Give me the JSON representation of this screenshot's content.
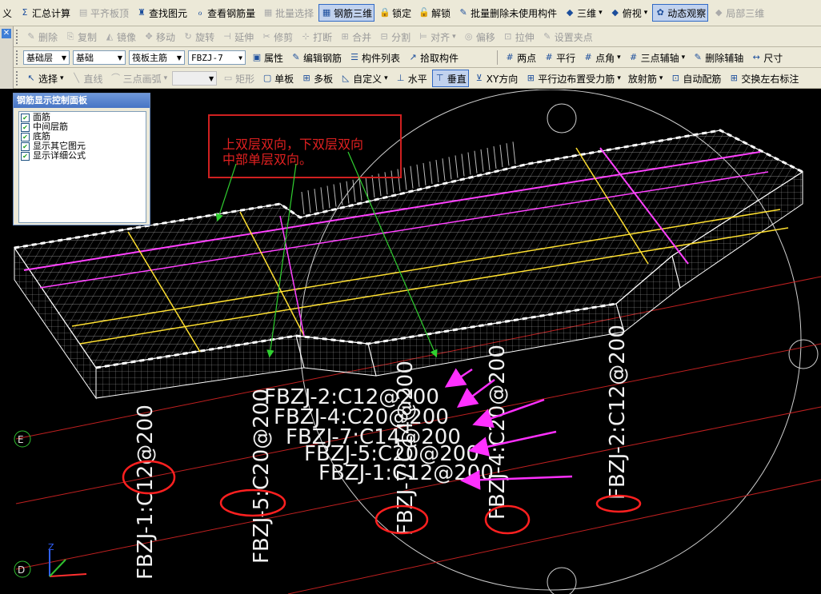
{
  "toolbar1": [
    {
      "label": "义",
      "icon": "",
      "disabled": false
    },
    {
      "label": "汇总计算",
      "icon": "Σ",
      "disabled": false
    },
    {
      "label": "平齐板顶",
      "icon": "▤",
      "disabled": true
    },
    {
      "label": "查找图元",
      "icon": "♜",
      "disabled": false
    },
    {
      "label": "查看钢筋量",
      "icon": "ℴ",
      "disabled": false
    },
    {
      "label": "批量选择",
      "icon": "▦",
      "disabled": true
    },
    {
      "label": "钢筋三维",
      "icon": "▦",
      "disabled": false,
      "active": true
    },
    {
      "label": "锁定",
      "icon": "🔒",
      "disabled": false
    },
    {
      "label": "解锁",
      "icon": "🔓",
      "disabled": false
    },
    {
      "label": "批量删除未使用构件",
      "icon": "✎",
      "disabled": false
    },
    {
      "label": "三维",
      "icon": "◆",
      "disabled": false,
      "dropdown": true
    },
    {
      "label": "俯视",
      "icon": "◆",
      "disabled": false,
      "dropdown": true
    },
    {
      "label": "动态观察",
      "icon": "✿",
      "disabled": false,
      "active": true
    },
    {
      "label": "局部三维",
      "icon": "◆",
      "disabled": true
    }
  ],
  "toolbar2": [
    {
      "label": "删除",
      "icon": "✎",
      "disabled": true
    },
    {
      "label": "复制",
      "icon": "⎘",
      "disabled": true
    },
    {
      "label": "镜像",
      "icon": "◭",
      "disabled": true
    },
    {
      "label": "移动",
      "icon": "✥",
      "disabled": true
    },
    {
      "label": "旋转",
      "icon": "↻",
      "disabled": true
    },
    {
      "label": "延伸",
      "icon": "⊣",
      "disabled": true
    },
    {
      "label": "修剪",
      "icon": "✂",
      "disabled": true
    },
    {
      "label": "打断",
      "icon": "⊹",
      "disabled": true
    },
    {
      "label": "合并",
      "icon": "⊞",
      "disabled": true
    },
    {
      "label": "分割",
      "icon": "⊟",
      "disabled": true
    },
    {
      "label": "对齐",
      "icon": "⊨",
      "disabled": true,
      "dropdown": true
    },
    {
      "label": "偏移",
      "icon": "◎",
      "disabled": true
    },
    {
      "label": "拉伸",
      "icon": "⊡",
      "disabled": true
    },
    {
      "label": "设置夹点",
      "icon": "✎",
      "disabled": true
    }
  ],
  "toolbar3": {
    "floor": "基础层",
    "category": "基础",
    "type": "筏板主筋",
    "element": "FBZJ-7",
    "buttons": [
      {
        "label": "属性",
        "icon": "▣"
      },
      {
        "label": "编辑钢筋",
        "icon": "✎"
      },
      {
        "label": "构件列表",
        "icon": "☰"
      },
      {
        "label": "拾取构件",
        "icon": "↗"
      }
    ],
    "buttons_right": [
      {
        "label": "两点",
        "icon": "#"
      },
      {
        "label": "平行",
        "icon": "#"
      },
      {
        "label": "点角",
        "icon": "#",
        "dropdown": true
      },
      {
        "label": "三点辅轴",
        "icon": "#",
        "dropdown": true
      },
      {
        "label": "删除辅轴",
        "icon": "✎"
      },
      {
        "label": "尺寸",
        "icon": "↔"
      }
    ]
  },
  "toolbar4": [
    {
      "label": "选择",
      "icon": "↖",
      "dropdown": true
    },
    {
      "label": "直线",
      "icon": "╲",
      "disabled": true
    },
    {
      "label": "三点画弧",
      "icon": "⌒",
      "disabled": true,
      "dropdown": true
    },
    {
      "label": "矩形",
      "icon": "▭",
      "disabled": true
    },
    {
      "label": "单板",
      "icon": "▢"
    },
    {
      "label": "多板",
      "icon": "⊞"
    },
    {
      "label": "自定义",
      "icon": "◺",
      "dropdown": true
    },
    {
      "label": "水平",
      "icon": "⊥"
    },
    {
      "label": "垂直",
      "icon": "⊤",
      "active": true
    },
    {
      "label": "XY方向",
      "icon": "⊻"
    },
    {
      "label": "平行边布置受力筋",
      "icon": "⊞",
      "dropdown": true
    },
    {
      "label": "放射筋",
      "icon": "",
      "dropdown": true
    },
    {
      "label": "自动配筋",
      "icon": "⊡"
    },
    {
      "label": "交换左右标注",
      "icon": "⊞"
    }
  ],
  "panel": {
    "title": "钢筋显示控制面板",
    "items": [
      {
        "label": "面筋",
        "checked": true
      },
      {
        "label": "中间层筋",
        "checked": true
      },
      {
        "label": "底筋",
        "checked": true
      },
      {
        "label": "显示其它图元",
        "checked": true
      },
      {
        "label": "显示详细公式",
        "checked": true
      }
    ]
  },
  "scene": {
    "annotation_line1": "上双层双向，下双层双向",
    "annotation_line2": "中部单层双向。",
    "axis_labels": {
      "e": "E",
      "d": "D",
      "z": "Z"
    },
    "colors": {
      "background": "#000000",
      "grid": "#c02020",
      "mesh": "#c8c8c8",
      "top_bar": "#ff40ff",
      "mid_bar": "#ffe030",
      "annotation": "#d02020",
      "arrow_green": "#30d030",
      "arrow_magenta": "#ff30ff",
      "circle": "#ff2020"
    },
    "vertical_labels": [
      {
        "text": "FBZJ-1:C12@200"
      },
      {
        "text": "FBZJ-5:C20@200"
      },
      {
        "text": "FBZJ-7:C14@200"
      },
      {
        "text": "FBZJ-4:C20@200"
      },
      {
        "text": "FBZJ-2:C12@200"
      }
    ],
    "stack_labels": [
      {
        "text": "FBZJ-2:C12@200"
      },
      {
        "text": "FBZJ-4:C20@200"
      },
      {
        "text": "FBZJ-7:C14@200"
      },
      {
        "text": "FBZJ-5:C20@200"
      },
      {
        "text": "FBZJ-1:C12@200"
      }
    ]
  }
}
